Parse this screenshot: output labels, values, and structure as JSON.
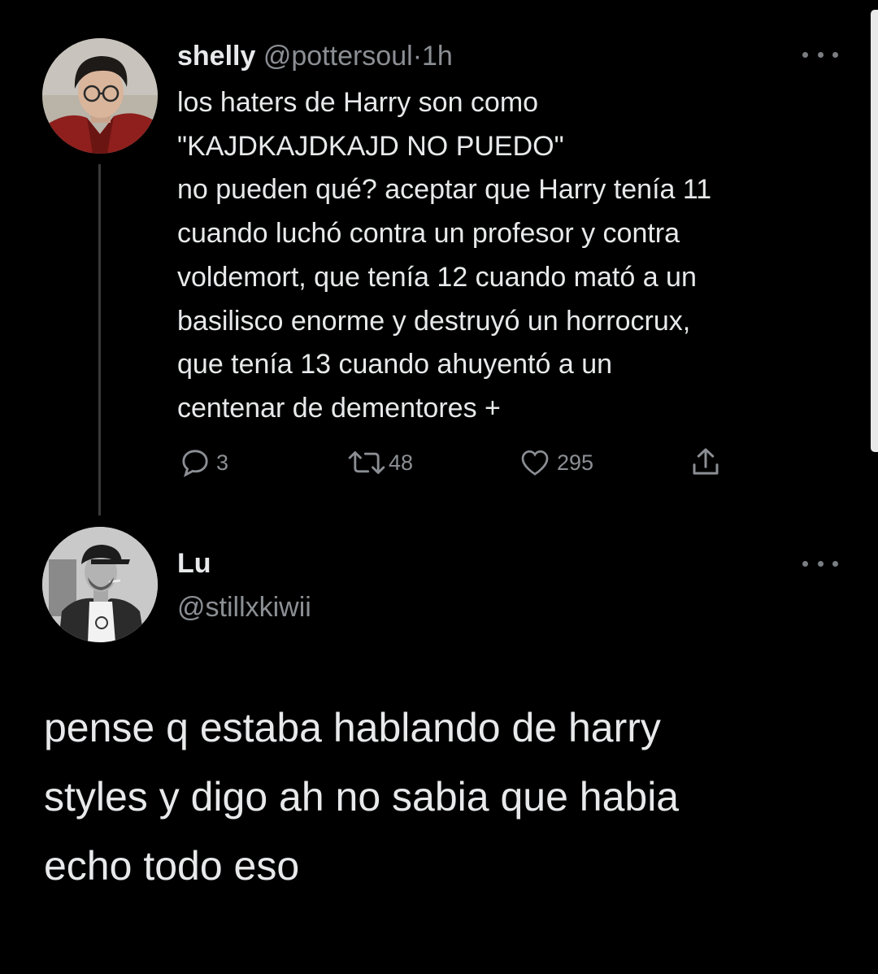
{
  "thread": {
    "tweet": {
      "display_name": "shelly",
      "handle": "@pottersoul",
      "separator": "·",
      "time": "1h",
      "text_lines": [
        "los haters de Harry son como",
        "\"KAJDKAJDKAJD NO PUEDO\"",
        "no pueden qué? aceptar que Harry tenía 11",
        "cuando luchó contra un profesor y contra",
        "voldemort, que tenía 12 cuando mató a un",
        "basilisco enorme y destruyó un horrocrux,",
        "que tenía 13 cuando ahuyentó a un",
        "centenar de dementores +"
      ],
      "actions": {
        "replies": "3",
        "retweets": "48",
        "likes": "295"
      },
      "icons": {
        "avatar": "avatar-photo",
        "more": "more-dots-icon",
        "reply": "reply-bubble-icon",
        "retweet": "retweet-arrows-icon",
        "like": "heart-icon",
        "share": "share-upload-icon"
      }
    },
    "reply": {
      "display_name": "Lu",
      "handle": "@stillxkiwii",
      "text_lines": [
        "pense q estaba hablando de harry",
        "styles y digo ah no sabia que habia",
        "echo todo eso"
      ]
    }
  },
  "colors": {
    "background": "#000000",
    "primary_text": "#e7e9ea",
    "secondary_text": "#8b8f94",
    "thread_line": "#3a3a3a"
  }
}
